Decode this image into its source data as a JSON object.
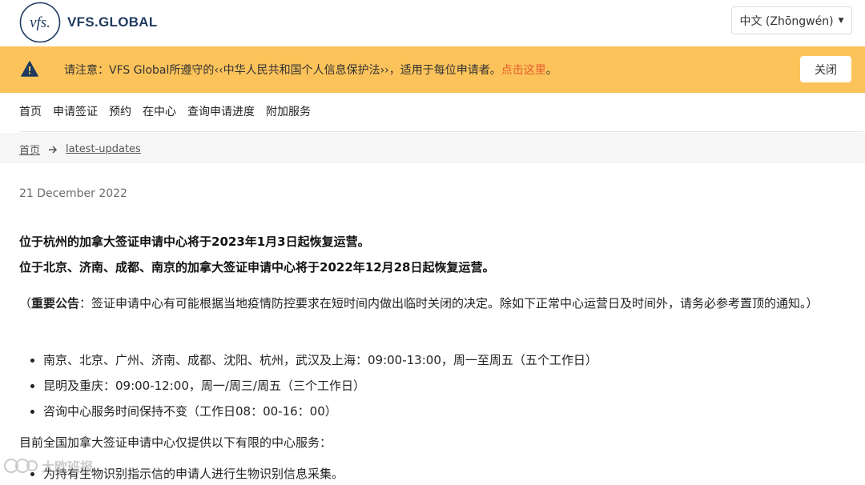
{
  "header": {
    "logo_mark": "vfs.",
    "logo_text": "VFS.GLOBAL",
    "language_label": "中文 (Zhōngwén)"
  },
  "alert": {
    "text": "请注意：VFS Global所遵守的‹‹中华人民共和国个人信息保护法››，适用于每位申请者。",
    "link": "点击这里",
    "suffix": "。",
    "close_label": "关闭"
  },
  "nav": {
    "items": [
      "首页",
      "申请签证",
      "预约",
      "在中心",
      "查询申请进度",
      "附加服务"
    ]
  },
  "breadcrumb": {
    "home": "首页",
    "current": "latest-updates"
  },
  "content": {
    "date": "21 December 2022",
    "headline_1": "位于杭州的加拿大签证申请中心将于2023年1月3日起恢复运营。",
    "headline_2": "位于北京、济南、成都、南京的加拿大签证申请中心将于2022年12月28日起恢复运营。",
    "notice_open": "（",
    "notice_bold": "重要公告",
    "notice_body": "：签证申请中心有可能根据当地疫情防控要求在短时间内做出临时关闭的决定。除如下正常中心运营日及时间外，请务必参考置顶的通知。）",
    "hours": [
      "南京、北京、广州、济南、成都、沈阳、杭州，武汉及上海：09:00-13:00，周一至周五（五个工作日）",
      "昆明及重庆：09:00-12:00，周一/周三/周五（三个工作日）",
      "咨询中心服务时间保持不变（工作日08：00-16：00）"
    ],
    "services_intro": "目前全国加拿大签证申请中心仅提供以下有限的中心服务：",
    "services": [
      "为持有生物识别指示信的申请人进行生物识别信息采集。"
    ]
  },
  "watermark": {
    "text": "大欧班报"
  }
}
